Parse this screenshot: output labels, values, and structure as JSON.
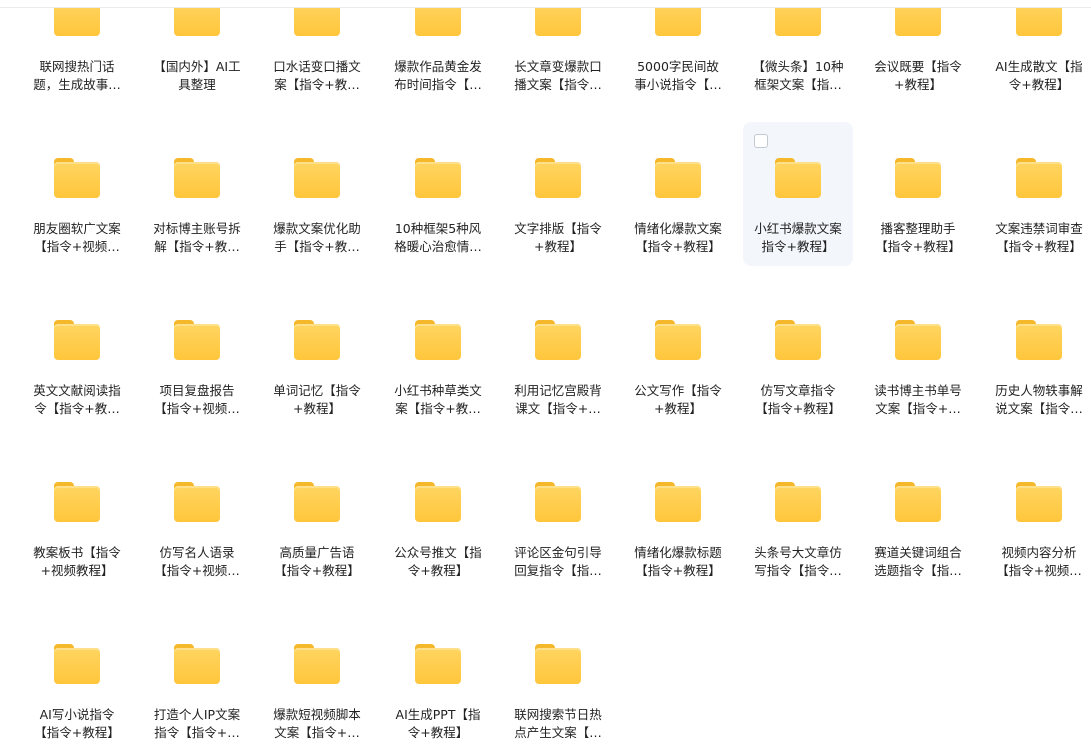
{
  "folders": [
    {
      "l1": "联网搜热门话",
      "l2": "题，生成故事…"
    },
    {
      "l1": "【国内外】AI工",
      "l2": "具整理"
    },
    {
      "l1": "口水话变口播文",
      "l2": "案【指令+教…"
    },
    {
      "l1": "爆款作品黄金发",
      "l2": "布时间指令【…"
    },
    {
      "l1": "长文章变爆款口",
      "l2": "播文案【指令…"
    },
    {
      "l1": "5000字民间故",
      "l2": "事小说指令【…"
    },
    {
      "l1": "【微头条】10种",
      "l2": "框架文案【指…"
    },
    {
      "l1": "会议既要【指令",
      "l2": "+教程】"
    },
    {
      "l1": "AI生成散文【指",
      "l2": "令+教程】"
    },
    {
      "l1": "朋友圈软广文案",
      "l2": "【指令+视频…"
    },
    {
      "l1": "对标博主账号拆",
      "l2": "解【指令+教…"
    },
    {
      "l1": "爆款文案优化助",
      "l2": "手【指令+教…"
    },
    {
      "l1": "10种框架5种风",
      "l2": "格暖心治愈情…"
    },
    {
      "l1": "文字排版【指令",
      "l2": "+教程】"
    },
    {
      "l1": "情绪化爆款文案",
      "l2": "【指令+教程】"
    },
    {
      "l1": "小红书爆款文案",
      "l2": "指令+教程】",
      "selected": true
    },
    {
      "l1": "播客整理助手",
      "l2": "【指令+教程】"
    },
    {
      "l1": "文案违禁词审查",
      "l2": "【指令+教程】"
    },
    {
      "l1": "英文文献阅读指",
      "l2": "令【指令+教…"
    },
    {
      "l1": "项目复盘报告",
      "l2": "【指令+视频…"
    },
    {
      "l1": "单词记忆【指令",
      "l2": "+教程】"
    },
    {
      "l1": "小红书种草类文",
      "l2": "案【指令+教…"
    },
    {
      "l1": "利用记忆宫殿背",
      "l2": "课文【指令+…"
    },
    {
      "l1": "公文写作【指令",
      "l2": "+教程】"
    },
    {
      "l1": "仿写文章指令",
      "l2": "【指令+教程】"
    },
    {
      "l1": "读书博主书单号",
      "l2": "文案【指令+…"
    },
    {
      "l1": "历史人物轶事解",
      "l2": "说文案【指令…"
    },
    {
      "l1": "教案板书【指令",
      "l2": "+视频教程】"
    },
    {
      "l1": "仿写名人语录",
      "l2": "【指令+视频…"
    },
    {
      "l1": "高质量广告语",
      "l2": "【指令+教程】"
    },
    {
      "l1": "公众号推文【指",
      "l2": "令+教程】"
    },
    {
      "l1": "评论区金句引导",
      "l2": "回复指令【指…"
    },
    {
      "l1": "情绪化爆款标题",
      "l2": "【指令+教程】"
    },
    {
      "l1": "头条号大文章仿",
      "l2": "写指令【指令…"
    },
    {
      "l1": "赛道关键词组合",
      "l2": "选题指令【指…"
    },
    {
      "l1": "视频内容分析",
      "l2": "【指令+视频…"
    },
    {
      "l1": "AI写小说指令",
      "l2": "【指令+教程】"
    },
    {
      "l1": "打造个人IP文案",
      "l2": "指令【指令+…"
    },
    {
      "l1": "爆款短视频脚本",
      "l2": "文案【指令+…"
    },
    {
      "l1": "AI生成PPT【指",
      "l2": "令+教程】"
    },
    {
      "l1": "联网搜索节日热",
      "l2": "点产生文案【…"
    }
  ],
  "colors": {
    "folder_body": "#ffc63b",
    "folder_tab": "#f5b82a",
    "selection_bg": "#f3f6fb"
  }
}
